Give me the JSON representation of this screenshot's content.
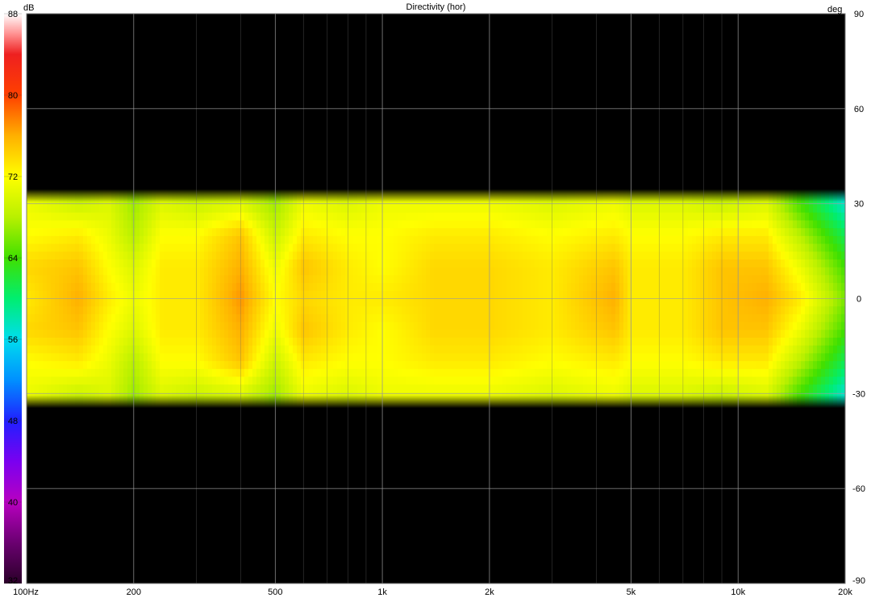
{
  "chart_data": {
    "type": "heatmap",
    "title": "Directivity (hor)",
    "x_unit_label": "100Hz",
    "x_scale": "log",
    "xlim": [
      100,
      20000
    ],
    "x_ticks": [
      {
        "value": 100,
        "label": "100Hz"
      },
      {
        "value": 200,
        "label": "200"
      },
      {
        "value": 500,
        "label": "500"
      },
      {
        "value": 1000,
        "label": "1k"
      },
      {
        "value": 2000,
        "label": "2k"
      },
      {
        "value": 5000,
        "label": "5k"
      },
      {
        "value": 10000,
        "label": "10k"
      },
      {
        "value": 20000,
        "label": "20k"
      }
    ],
    "y_unit_label": "deg",
    "ylim": [
      -90,
      90
    ],
    "y_ticks": [
      90,
      60,
      30,
      0,
      -30,
      -60,
      -90
    ],
    "colorbar": {
      "unit_label": "dB",
      "range": [
        32,
        88
      ],
      "ticks": [
        88,
        80,
        72,
        64,
        56,
        48,
        40,
        32
      ],
      "stops": [
        {
          "value": 32,
          "color": "#2a0028"
        },
        {
          "value": 36,
          "color": "#6a0070"
        },
        {
          "value": 40,
          "color": "#b800c0"
        },
        {
          "value": 44,
          "color": "#7a00f0"
        },
        {
          "value": 48,
          "color": "#2020ff"
        },
        {
          "value": 52,
          "color": "#0090ff"
        },
        {
          "value": 56,
          "color": "#00ddee"
        },
        {
          "value": 60,
          "color": "#00ee70"
        },
        {
          "value": 64,
          "color": "#40e000"
        },
        {
          "value": 68,
          "color": "#b8f000"
        },
        {
          "value": 72,
          "color": "#ffff00"
        },
        {
          "value": 76,
          "color": "#ffb000"
        },
        {
          "value": 80,
          "color": "#ff4000"
        },
        {
          "value": 84,
          "color": "#ee2020"
        },
        {
          "value": 86,
          "color": "#ff9090"
        },
        {
          "value": 88,
          "color": "#ffffff"
        }
      ]
    },
    "background_color": "#000000",
    "grid": true,
    "measured_angle_range": [
      -30,
      30
    ],
    "frequencies": [
      100,
      140,
      170,
      200,
      240,
      300,
      400,
      500,
      600,
      800,
      1000,
      1400,
      2000,
      3000,
      4500,
      5000,
      7000,
      9000,
      12000,
      15000,
      20000
    ],
    "angles": [
      -30,
      -20,
      -10,
      0,
      10,
      20,
      30
    ],
    "values_db": [
      [
        71,
        69,
        70,
        67,
        70,
        69,
        70,
        67,
        71,
        70,
        71,
        71,
        71,
        70,
        71,
        70,
        70,
        69,
        70,
        64,
        57
      ],
      [
        72,
        73,
        71,
        68,
        72,
        72,
        75,
        69,
        73,
        72,
        72,
        73,
        73,
        72,
        73,
        72,
        72,
        73,
        73,
        68,
        61
      ],
      [
        74,
        75,
        72,
        70,
        73,
        73,
        76,
        71,
        75,
        73,
        72,
        74,
        74,
        73,
        75,
        73,
        73,
        75,
        75,
        71,
        64
      ],
      [
        73,
        76,
        73,
        71,
        73,
        73,
        77,
        72,
        74,
        73,
        73,
        74,
        74,
        73,
        76,
        73,
        73,
        75,
        76,
        73,
        66
      ],
      [
        74,
        75,
        72,
        70,
        73,
        73,
        76,
        71,
        75,
        73,
        72,
        74,
        74,
        73,
        75,
        73,
        73,
        75,
        75,
        71,
        64
      ],
      [
        72,
        73,
        71,
        68,
        72,
        72,
        75,
        69,
        73,
        72,
        72,
        73,
        73,
        72,
        73,
        72,
        72,
        73,
        73,
        68,
        61
      ],
      [
        71,
        69,
        70,
        67,
        70,
        69,
        70,
        67,
        71,
        70,
        71,
        71,
        71,
        70,
        71,
        70,
        70,
        69,
        70,
        64,
        57
      ]
    ]
  }
}
